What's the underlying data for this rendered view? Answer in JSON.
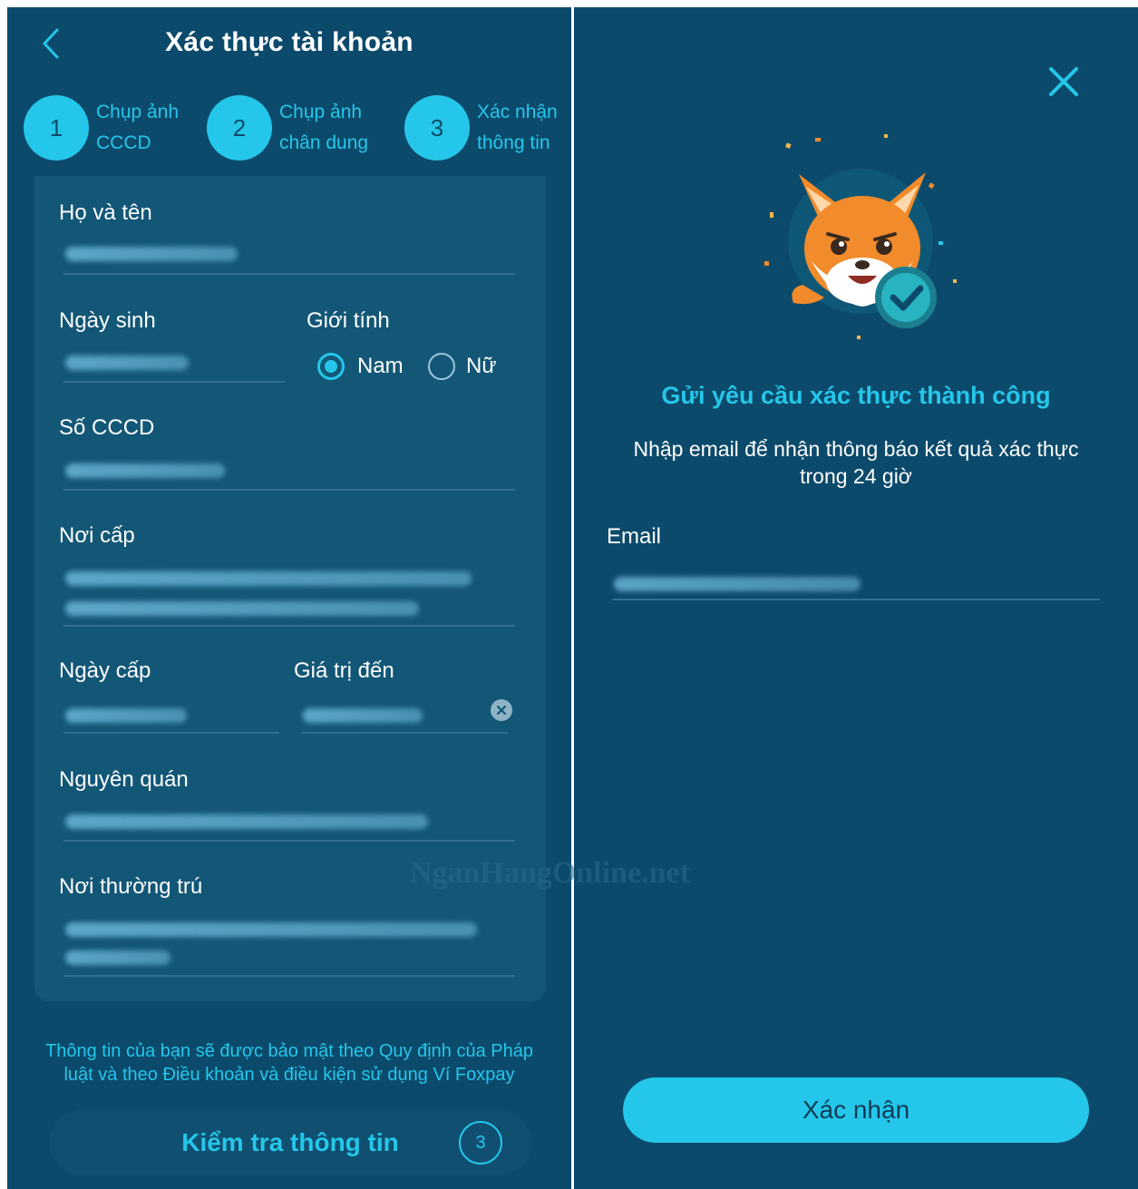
{
  "header": {
    "title": "Xác thực tài khoản"
  },
  "steps": [
    {
      "number": "1",
      "line1": "Chụp ảnh",
      "line2": "CCCD"
    },
    {
      "number": "2",
      "line1": "Chụp ảnh",
      "line2": "chân dung"
    },
    {
      "number": "3",
      "line1": "Xác nhận",
      "line2": "thông tin"
    }
  ],
  "form": {
    "full_name_label": "Họ và tên",
    "dob_label": "Ngày sinh",
    "gender_label": "Giới tính",
    "gender_options": [
      "Nam",
      "Nữ"
    ],
    "gender_selected": "Nam",
    "id_label": "Số CCCD",
    "issue_place_label": "Nơi cấp",
    "issue_date_label": "Ngày cấp",
    "expiry_label": "Giá trị đến",
    "hometown_label": "Nguyên quán",
    "residence_label": "Nơi thường trú"
  },
  "privacy": {
    "line1": "Thông tin của bạn sẽ được bảo mật theo Quy định của Pháp",
    "line2": "luật và theo Điều khoản và điều kiện sử dụng Ví Foxpay"
  },
  "check_button": {
    "label": "Kiểm tra thông tin",
    "count": "3"
  },
  "success": {
    "title": "Gửi yêu cầu xác thực thành công",
    "subtitle_line1": "Nhập email để nhận thông báo kết quả xác thực",
    "subtitle_line2": "trong 24 giờ",
    "email_label": "Email"
  },
  "confirm_button": {
    "label": "Xác nhận"
  },
  "watermark": "NganHangOnline.net",
  "colors": {
    "background": "#0c4a6b",
    "card": "#135777",
    "accent": "#24c7ea",
    "mascot": "#f28b2b"
  },
  "icons": [
    "back-arrow-icon",
    "close-icon",
    "clear-icon",
    "fox-mascot-icon",
    "check-badge-icon"
  ]
}
